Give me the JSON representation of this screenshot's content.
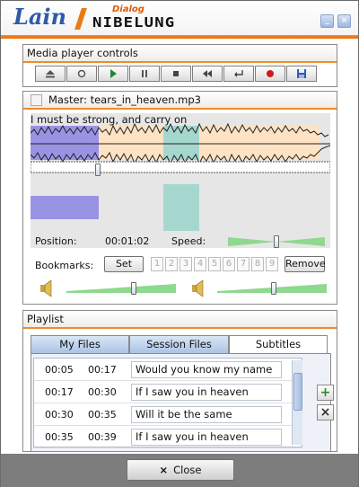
{
  "header": {
    "brand": "Lain",
    "product_small": "Dialog",
    "product": "NIBELUNG",
    "minimize_icon": "minimize-icon",
    "close_icon": "close-icon"
  },
  "media_controls": {
    "title": "Media player controls",
    "buttons": [
      {
        "name": "eject-button",
        "icon": "eject-icon"
      },
      {
        "name": "record-indicator-button",
        "icon": "circle-icon"
      },
      {
        "name": "play-button",
        "icon": "play-icon"
      },
      {
        "name": "pause-button",
        "icon": "pause-icon"
      },
      {
        "name": "stop-button",
        "icon": "stop-icon"
      },
      {
        "name": "rewind-button",
        "icon": "rewind-icon"
      },
      {
        "name": "loop-button",
        "icon": "return-icon"
      },
      {
        "name": "record-button",
        "icon": "record-icon"
      },
      {
        "name": "save-button",
        "icon": "save-icon"
      }
    ]
  },
  "master": {
    "label": "Master: tears_in_heaven.mp3",
    "lyric": "I must be strong, and carry on",
    "position_label": "Position:",
    "position_value": "00:01:02",
    "speed_label": "Speed:",
    "speed_level": 0.5,
    "seek_level": 0.22,
    "bookmarks_label": "Bookmarks:",
    "set_label": "Set",
    "bookmark_numbers": [
      "1",
      "2",
      "3",
      "4",
      "5",
      "6",
      "7",
      "8",
      "9"
    ],
    "remove_label": "Remove",
    "volume_left_level": 0.62,
    "volume_right_level": 0.52
  },
  "playlist": {
    "title": "Playlist",
    "tabs": [
      "My Files",
      "Session Files",
      "Subtitles"
    ],
    "active_tab": "Subtitles",
    "rows": [
      {
        "start": "00:05",
        "end": "00:17",
        "text": "Would you know my name"
      },
      {
        "start": "00:17",
        "end": "00:30",
        "text": "If I saw you in heaven"
      },
      {
        "start": "00:30",
        "end": "00:35",
        "text": "Will it be the same"
      },
      {
        "start": "00:35",
        "end": "00:39",
        "text": "If I saw you in heaven"
      }
    ],
    "add_icon": "plus-icon",
    "remove_icon": "x-icon"
  },
  "footer": {
    "close_label": "Close",
    "close_icon": "x-icon"
  },
  "colors": {
    "accent_orange": "#f28a2c",
    "brand_blue": "#2f5aa8",
    "waveform_orange": "#fde3c4",
    "waveform_blue": "#9a93e4",
    "waveform_teal": "#a6d7cf",
    "slider_green": "#8fd88f"
  }
}
